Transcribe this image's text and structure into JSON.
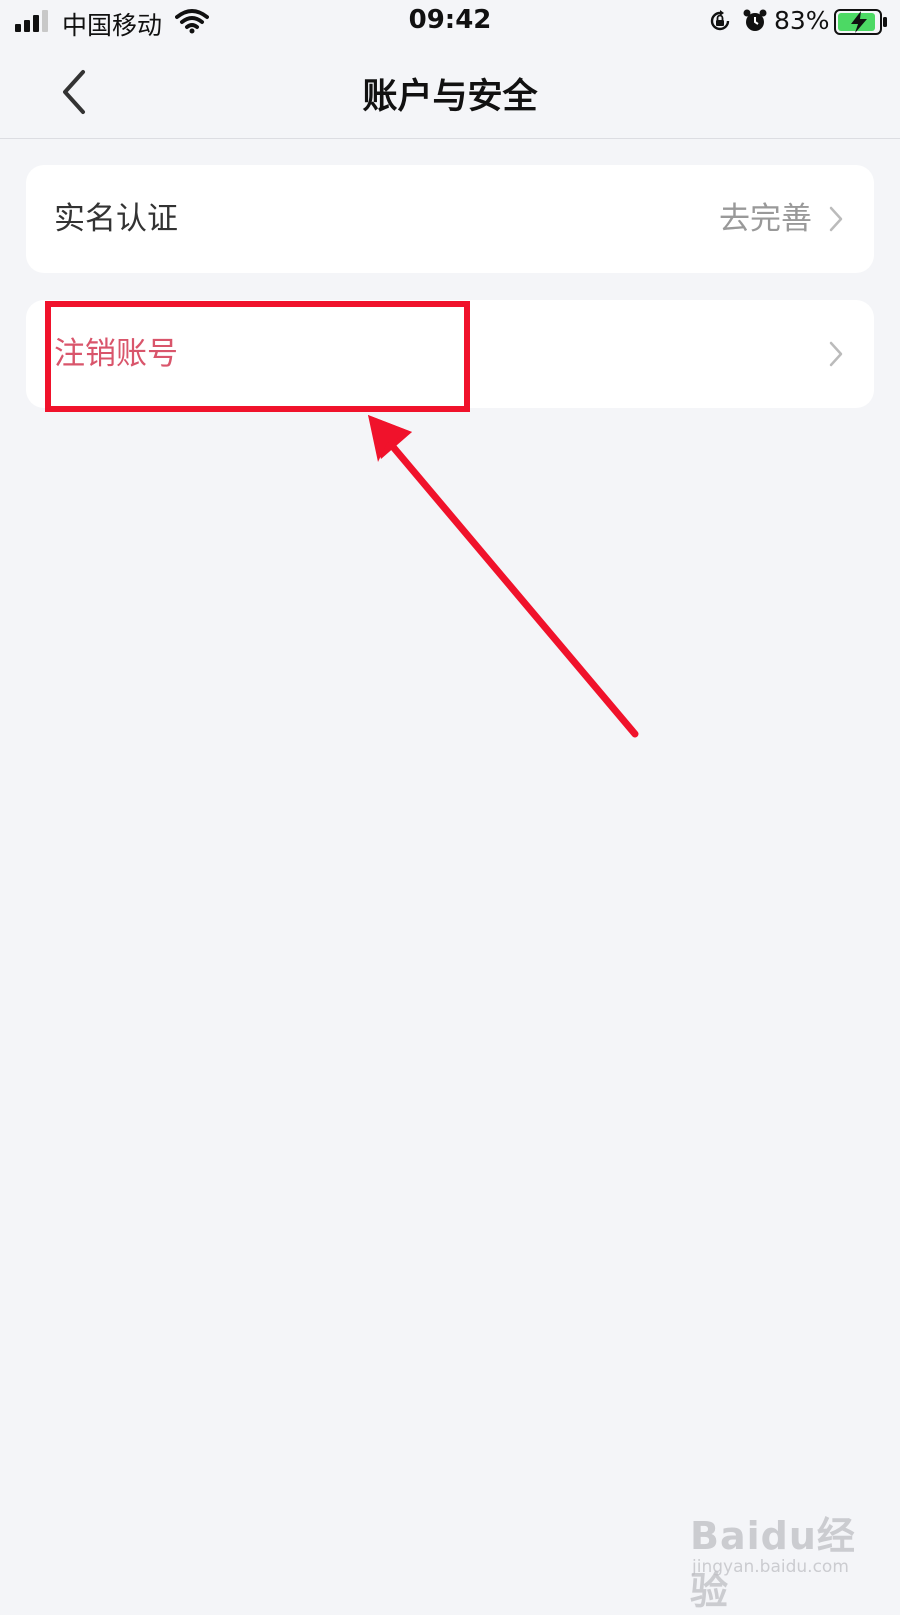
{
  "status_bar": {
    "carrier": "中国移动",
    "time": "09:42",
    "battery_percent": "83%",
    "icons": [
      "signal-icon",
      "wifi-icon",
      "rotation-lock-icon",
      "alarm-icon",
      "battery-charging-icon"
    ]
  },
  "nav": {
    "title": "账户与安全",
    "back_icon": "chevron-left-icon"
  },
  "menu": {
    "items": [
      {
        "label": "实名认证",
        "value": "去完善"
      },
      {
        "label": "注销账号",
        "value": ""
      }
    ]
  },
  "annotation": {
    "highlight_color": "#f0122b",
    "target": "注销账号"
  },
  "watermark": {
    "logo": "Baidu经验",
    "url": "jingyan.baidu.com"
  },
  "colors": {
    "background": "#f4f5f8",
    "card": "#ffffff",
    "danger_text": "#d9556b",
    "muted_text": "#999999",
    "battery_green": "#4cd964"
  }
}
